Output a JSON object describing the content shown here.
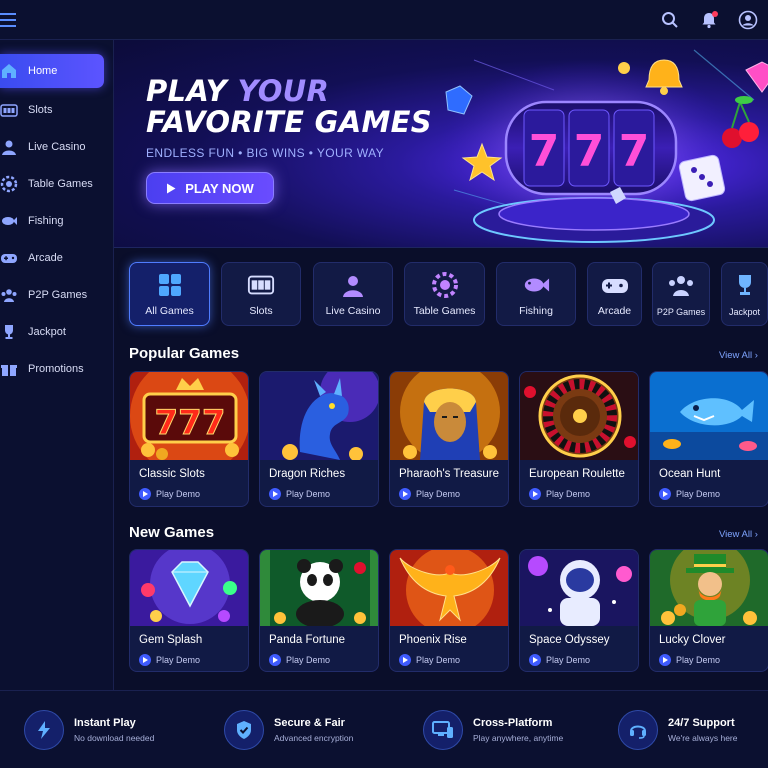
{
  "header": {
    "icons": [
      "menu-icon",
      "search-icon",
      "bell-icon",
      "user-icon"
    ],
    "accent": "#5a8dff"
  },
  "sidebar": {
    "items": [
      {
        "label": "Home",
        "icon": "home-icon",
        "active": true
      },
      {
        "label": "Slots",
        "icon": "slot-machine-icon"
      },
      {
        "label": "Live Casino",
        "icon": "dealer-icon"
      },
      {
        "label": "Table Games",
        "icon": "chip-icon"
      },
      {
        "label": "Fishing",
        "icon": "fish-icon"
      },
      {
        "label": "Arcade",
        "icon": "gamepad-icon"
      },
      {
        "label": "P2P Games",
        "icon": "users-icon"
      },
      {
        "label": "Jackpot",
        "icon": "trophy-icon"
      },
      {
        "label": "Promotions",
        "icon": "gift-icon"
      }
    ]
  },
  "hero": {
    "title_line1_a": "PLAY",
    "title_line1_b": "YOUR",
    "title_line2": "FAVORITE GAMES",
    "subtitle": "ENDLESS FUN  •  BIG WINS  •  YOUR WAY",
    "cta_label": "PLAY NOW",
    "reel_digits": [
      "7",
      "7",
      "7"
    ]
  },
  "categories": [
    {
      "label": "All Games",
      "icon": "grid-icon",
      "active": true
    },
    {
      "label": "Slots",
      "icon": "slot-machine-icon"
    },
    {
      "label": "Live Casino",
      "icon": "dealer-icon"
    },
    {
      "label": "Table Games",
      "icon": "chip-icon"
    },
    {
      "label": "Fishing",
      "icon": "fish-icon"
    },
    {
      "label": "Arcade",
      "icon": "gamepad-icon"
    },
    {
      "label": "P2P Games",
      "icon": "users-icon"
    },
    {
      "label": "Jackpot",
      "icon": "trophy-icon"
    }
  ],
  "popular": {
    "title": "Popular Games",
    "view_all": "View All",
    "games": [
      {
        "title": "Classic Slots",
        "demo": "Play Demo",
        "art": "slots-777"
      },
      {
        "title": "Dragon Riches",
        "demo": "Play Demo",
        "art": "dragon"
      },
      {
        "title": "Pharaoh's Treasure",
        "demo": "Play Demo",
        "art": "pharaoh"
      },
      {
        "title": "European Roulette",
        "demo": "Play Demo",
        "art": "roulette"
      },
      {
        "title": "Ocean Hunt",
        "demo": "Play Demo",
        "art": "ocean"
      }
    ]
  },
  "new_games": {
    "title": "New Games",
    "view_all": "View All",
    "games": [
      {
        "title": "Gem Splash",
        "demo": "Play Demo",
        "art": "gem"
      },
      {
        "title": "Panda Fortune",
        "demo": "Play Demo",
        "art": "panda"
      },
      {
        "title": "Phoenix Rise",
        "demo": "Play Demo",
        "art": "phoenix"
      },
      {
        "title": "Space Odyssey",
        "demo": "Play Demo",
        "art": "astronaut"
      },
      {
        "title": "Lucky Clover",
        "demo": "Play Demo",
        "art": "leprechaun"
      }
    ]
  },
  "features": [
    {
      "title": "Instant Play",
      "subtitle": "No download needed",
      "icon": "lightning-icon"
    },
    {
      "title": "Secure & Fair",
      "subtitle": "Advanced encryption",
      "icon": "shield-icon"
    },
    {
      "title": "Cross-Platform",
      "subtitle": "Play anywhere, anytime",
      "icon": "devices-icon"
    },
    {
      "title": "24/7 Support",
      "subtitle": "We're always here",
      "icon": "headset-icon"
    }
  ]
}
